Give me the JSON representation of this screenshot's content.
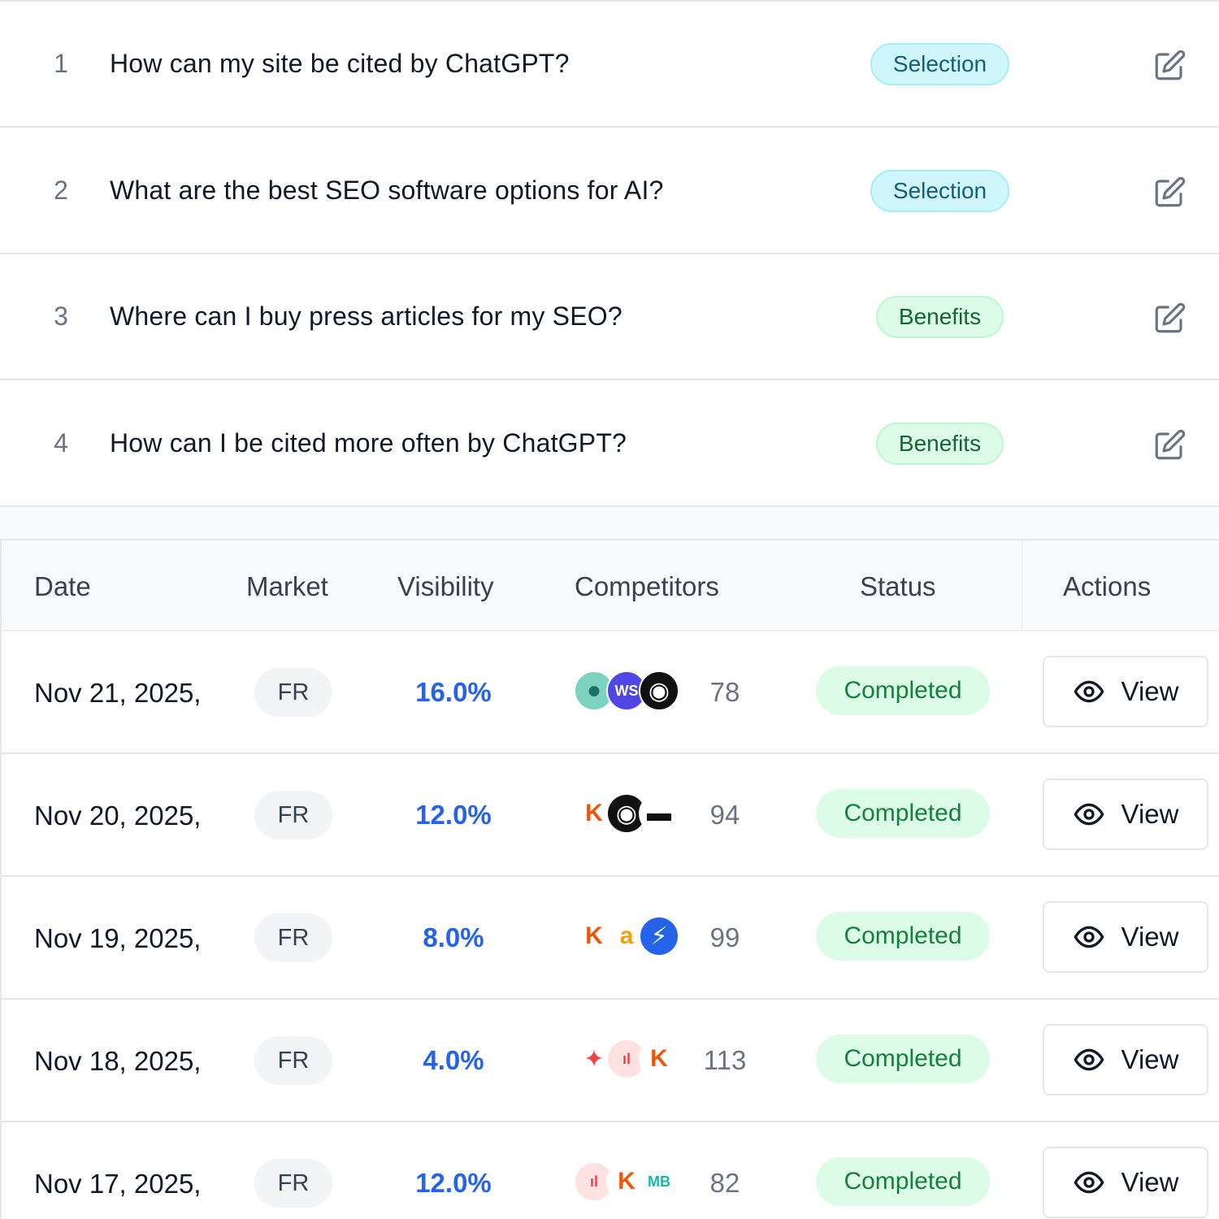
{
  "prompts": [
    {
      "num": "1",
      "text": "How can my site be cited by ChatGPT?",
      "tag": "Selection"
    },
    {
      "num": "2",
      "text": "What are the best SEO software options for AI?",
      "tag": "Selection"
    },
    {
      "num": "3",
      "text": "Where can I buy press articles for my SEO?",
      "tag": "Benefits"
    },
    {
      "num": "4",
      "text": "How can I be cited more often by ChatGPT?",
      "tag": "Benefits"
    }
  ],
  "table": {
    "headers": {
      "date": "Date",
      "market": "Market",
      "visibility": "Visibility",
      "competitors": "Competitors",
      "status": "Status",
      "actions": "Actions"
    },
    "rows": [
      {
        "date": "Nov 21, 2025,",
        "market": "FR",
        "visibility": "16.0%",
        "competitor_count": "78",
        "status": "Completed",
        "action": "View",
        "logos": [
          {
            "icon": "robot-logo-icon",
            "glyph": "●",
            "bg": "#7dd3c0",
            "fg": "#1f6f66"
          },
          {
            "icon": "ws-logo-icon",
            "glyph": "WS",
            "bg": "#4f46e5",
            "fg": "#ffffff"
          },
          {
            "icon": "penguin-logo-icon",
            "glyph": "◉",
            "bg": "#111111",
            "fg": "#ffffff"
          }
        ]
      },
      {
        "date": "Nov 20, 2025,",
        "market": "FR",
        "visibility": "12.0%",
        "competitor_count": "94",
        "status": "Completed",
        "action": "View",
        "logos": [
          {
            "icon": "k-logo-icon",
            "glyph": "K",
            "bg": "#ffffff",
            "fg": "#ea580c"
          },
          {
            "icon": "penguin-logo-icon",
            "glyph": "◉",
            "bg": "#111111",
            "fg": "#ffffff"
          },
          {
            "icon": "black-bars-logo-icon",
            "glyph": "▬",
            "bg": "#ffffff",
            "fg": "#111111"
          }
        ]
      },
      {
        "date": "Nov 19, 2025,",
        "market": "FR",
        "visibility": "8.0%",
        "competitor_count": "99",
        "status": "Completed",
        "action": "View",
        "logos": [
          {
            "icon": "k-logo-icon",
            "glyph": "K",
            "bg": "#ffffff",
            "fg": "#ea580c"
          },
          {
            "icon": "a-logo-icon",
            "glyph": "a",
            "bg": "#ffffff",
            "fg": "#f59e0b"
          },
          {
            "icon": "bolt-logo-icon",
            "glyph": "⚡",
            "bg": "#2563eb",
            "fg": "#ffffff"
          }
        ]
      },
      {
        "date": "Nov 18, 2025,",
        "market": "FR",
        "visibility": "4.0%",
        "competitor_count": "113",
        "status": "Completed",
        "action": "View",
        "logos": [
          {
            "icon": "flame-logo-icon",
            "glyph": "✦",
            "bg": "#ffffff",
            "fg": "#ef4444"
          },
          {
            "icon": "bars-logo-icon",
            "glyph": "ıl",
            "bg": "#fee2e2",
            "fg": "#ef4444"
          },
          {
            "icon": "k-logo-icon",
            "glyph": "K",
            "bg": "#ffffff",
            "fg": "#ea580c"
          }
        ]
      },
      {
        "date": "Nov 17, 2025,",
        "market": "FR",
        "visibility": "12.0%",
        "competitor_count": "82",
        "status": "Completed",
        "action": "View",
        "logos": [
          {
            "icon": "bars-logo-icon",
            "glyph": "ıl",
            "bg": "#fee2e2",
            "fg": "#ef4444"
          },
          {
            "icon": "k-logo-icon",
            "glyph": "K",
            "bg": "#ffffff",
            "fg": "#ea580c"
          },
          {
            "icon": "mb-logo-icon",
            "glyph": "MB",
            "bg": "#ffffff",
            "fg": "#14b8a6"
          }
        ]
      }
    ]
  },
  "colors": {
    "accent": "#2563eb",
    "selection_bg": "#cff7fb",
    "benefits_bg": "#dcfce7",
    "completed_text": "#15803d"
  }
}
